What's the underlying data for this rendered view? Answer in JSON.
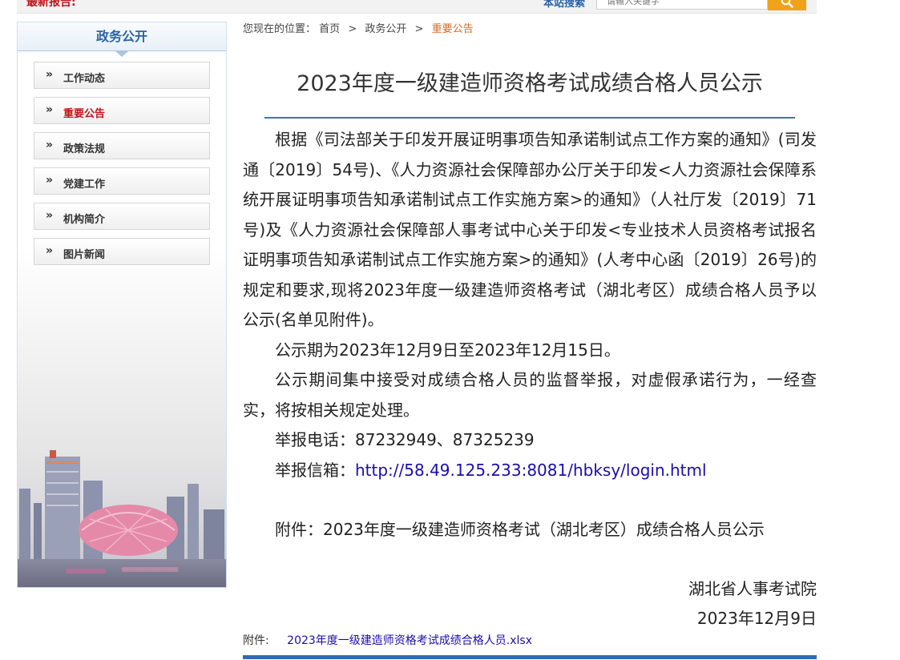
{
  "topbar": {
    "news_label": "最新报告:",
    "search_label": "本站搜索",
    "search_placeholder": "请输入关键字"
  },
  "sidebar": {
    "title": "政务公开",
    "items": [
      {
        "arrow": "»",
        "label": "工作动态"
      },
      {
        "arrow": "»",
        "label": "重要公告"
      },
      {
        "arrow": "»",
        "label": "政策法规"
      },
      {
        "arrow": "»",
        "label": "党建工作"
      },
      {
        "arrow": "»",
        "label": "机构简介"
      },
      {
        "arrow": "»",
        "label": "图片新闻"
      }
    ],
    "active_index": 1
  },
  "breadcrumb": {
    "prefix": "您现在的位置：",
    "home": "首页",
    "section": "政务公开",
    "current": "重要公告",
    "sep": ">"
  },
  "article": {
    "title": "2023年度一级建造师资格考试成绩合格人员公示",
    "para1": "根据《司法部关于印发开展证明事项告知承诺制试点工作方案的通知》(司发通〔2019〕54号)、《人力资源社会保障部办公厅关于印发<人力资源社会保障系统开展证明事项告知承诺制试点工作实施方案>的通知》（人社厅发〔2019〕71号)及《人力资源社会保障部人事考试中心关于印发<专业技术人员资格考试报名证明事项告知承诺制试点工作实施方案>的通知》(人考中心函〔2019〕26号)的规定和要求,现将2023年度一级建造师资格考试（湖北考区）成绩合格人员予以公示(名单见附件)。",
    "para2": "公示期为2023年12月9日至2023年12月15日。",
    "para3": "公示期间集中接受对成绩合格人员的监督举报，对虚假承诺行为，一经查实，将按相关规定处理。",
    "phone_label": "举报电话：",
    "phone_value": "87232949、87325239",
    "mail_label": "举报信箱：",
    "mail_link": "http://58.49.125.233:8081/hbksy/login.html",
    "attachment_note": "附件：2023年度一级建造师资格考试（湖北考区）成绩合格人员公示",
    "signer": "湖北省人事考试院",
    "date": "2023年12月9日"
  },
  "attachment": {
    "label": "附件:",
    "file": "2023年度一级建造师资格考试成绩合格人员.xlsx"
  },
  "colors": {
    "brand_blue": "#2a62a8",
    "active_red": "#c0151b",
    "breadcrumb_current": "#e06a1a",
    "search_button": "#f0a21a",
    "link": "#1a0dab"
  }
}
